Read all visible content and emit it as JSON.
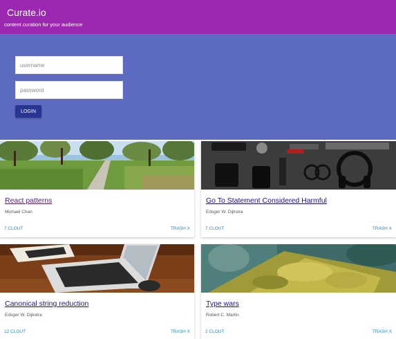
{
  "app": {
    "title": "Curate.io",
    "subtitle": "content curation for your audience"
  },
  "login": {
    "username_placeholder": "username",
    "username_value": "",
    "password_placeholder": "password",
    "password_value": "",
    "button_label": "LOGIN"
  },
  "colors": {
    "appbar": "#9c27b0",
    "login_panel": "#5c6bc0",
    "login_button": "#283593",
    "link_visited": "#551a8b",
    "link": "#1a0dab",
    "action": "#1e88e5"
  },
  "cards": [
    {
      "title": "React patterns",
      "author": "Michael Chan",
      "clout": "7 CLOUT",
      "trash": "TRASH X",
      "image": "park-path-image"
    },
    {
      "title": "Go To Statement Considered Harmful",
      "author": "Edsger W. Dijkstra",
      "clout": "7 CLOUT",
      "trash": "TRASH X",
      "image": "desk-accessories-image"
    },
    {
      "title": "Canonical string reduction",
      "author": "Edsger W. Dijkstra",
      "clout": "12 CLOUT",
      "trash": "TRASH X",
      "image": "laptop-notebook-image"
    },
    {
      "title": "Type wars",
      "author": "Robert C. Martin",
      "clout": "2 CLOUT",
      "trash": "TRASH X",
      "image": "mossy-tree-image"
    }
  ]
}
